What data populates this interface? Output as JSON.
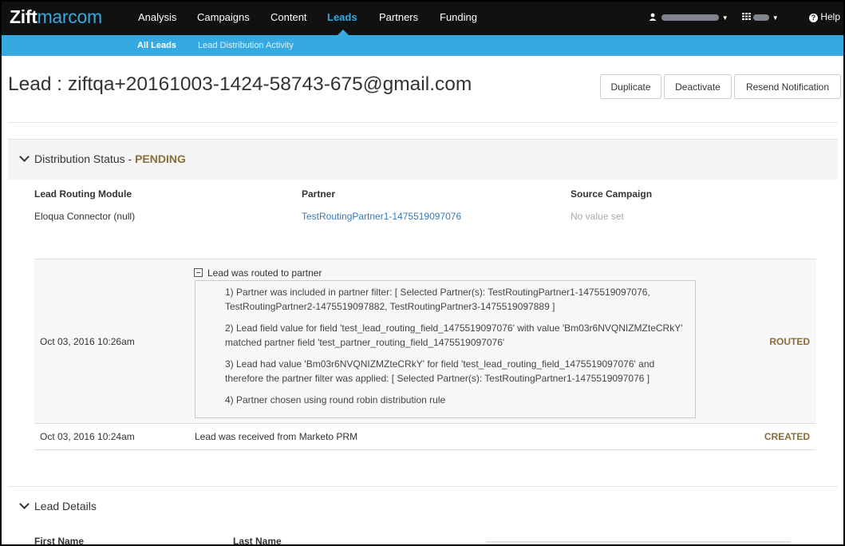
{
  "nav": {
    "logo_bold": "Zift",
    "logo_light": "marcom",
    "items": [
      "Analysis",
      "Campaigns",
      "Content",
      "Leads",
      "Partners",
      "Funding"
    ],
    "active": "Leads",
    "help": "Help"
  },
  "subnav": {
    "items": [
      "All Leads",
      "Lead Distribution Activity"
    ]
  },
  "header": {
    "title": "Lead : ziftqa+20161003-1424-58743-675@gmail.com",
    "buttons": [
      "Duplicate",
      "Deactivate",
      "Resend Notification"
    ]
  },
  "distribution": {
    "label": "Distribution Status - ",
    "status": "PENDING",
    "columns": [
      "Lead Routing Module",
      "Partner",
      "Source Campaign"
    ],
    "values": [
      "Eloqua Connector (null)",
      "TestRoutingPartner1-1475519097076",
      "No value set"
    ]
  },
  "history": [
    {
      "date": "Oct 03, 2016 10:26am",
      "title": "Lead was routed to partner",
      "steps": [
        "1) Partner was included in partner filter: [ Selected Partner(s): TestRoutingPartner1-1475519097076, TestRoutingPartner2-1475519097882, TestRoutingPartner3-1475519097889 ]",
        "2) Lead field value for field 'test_lead_routing_field_1475519097076' with value 'Bm03r6NVQNIZMZteCRkY' matched partner field 'test_partner_routing_field_1475519097076'",
        "3) Lead had value 'Bm03r6NVQNIZMZteCRkY' for field 'test_lead_routing_field_1475519097076' and therefore the partner filter was applied: [ Selected Partner(s): TestRoutingPartner1-1475519097076 ]",
        "4) Partner chosen using round robin distribution rule"
      ],
      "status": "ROUTED"
    },
    {
      "date": "Oct 03, 2016 10:24am",
      "title": "Lead was received from Marketo PRM",
      "status": "CREATED"
    }
  ],
  "details": {
    "label": "Lead Details",
    "fields": [
      "First Name",
      "Last Name"
    ]
  }
}
